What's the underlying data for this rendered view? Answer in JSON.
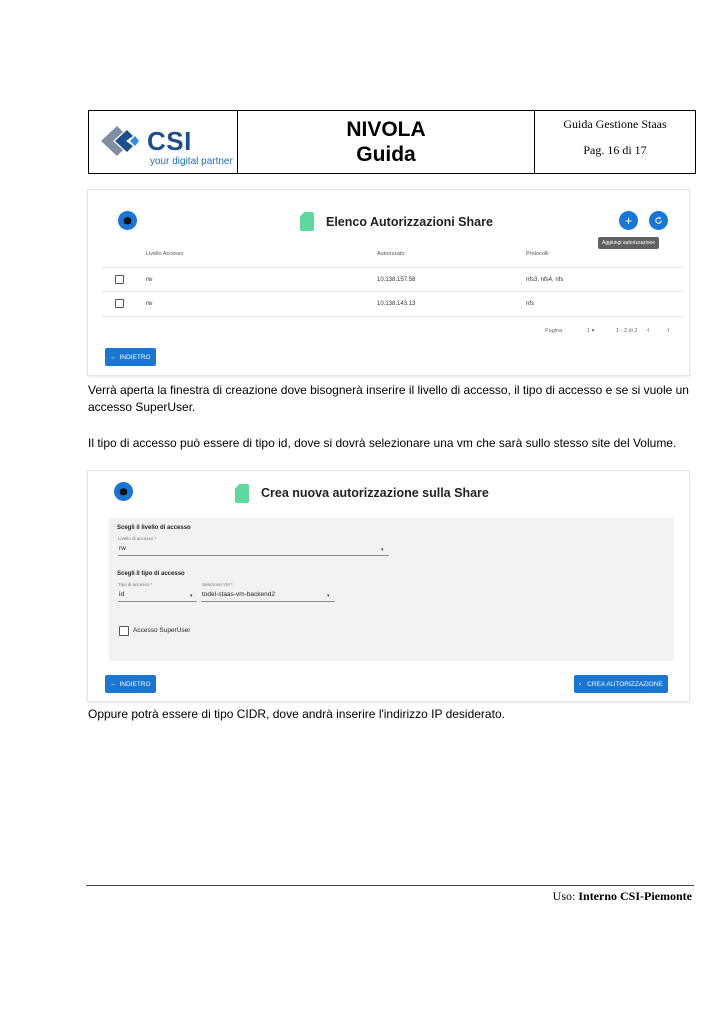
{
  "header": {
    "logo_text": "CSI",
    "logo_tagline": "your digital partner",
    "title": "NIVOLA",
    "subtitle": "Guida",
    "guide_name": "Guida Gestione Staas",
    "page": "Pag. 16 di 17"
  },
  "screenshot1": {
    "title": "Elenco Autorizzazioni Share",
    "add_icon": "plus-icon",
    "refresh_icon": "refresh-icon",
    "tooltip": "Aggiungi autorizzazione",
    "columns": [
      "Livello Accesso",
      "Autorizzato",
      "Protocolli"
    ],
    "rows": [
      {
        "livello": "rw",
        "autorizzato": "10.138.157.58",
        "protocolli": "nfs3, nfs4, nfs"
      },
      {
        "livello": "rw",
        "autorizzato": "10.138.143.13",
        "protocolli": "nfs"
      }
    ],
    "pagination": {
      "label": "Pagina",
      "page": "1",
      "range": "1 - 2 di 2"
    },
    "back_button": "INDIETRO"
  },
  "paragraphs": {
    "p1": "Verrà aperta la finestra di creazione dove bisognerà inserire il livello di accesso, il tipo di accesso e se si vuole un accesso SuperUser.",
    "p2": "Il tipo di accesso può essere di tipo id, dove si dovrà selezionare una vm che sarà sullo stesso site del Volume.",
    "p3": "Oppure potrà essere di tipo CIDR, dove andrà inserire l'indirizzo IP desiderato."
  },
  "screenshot2": {
    "title": "Crea nuova autorizzazione sulla Share",
    "section1_title": "Scegli il livello di accesso",
    "livello_label": "Livello di accesso *",
    "livello_value": "rw",
    "section2_title": "Scegli il tipo di accesso",
    "tipo_label": "Tipo di accesso *",
    "tipo_value": "id",
    "vm_label": "Seleziona VM *",
    "vm_value": "todel-staas-vm-backend2",
    "superuser_label": "Accesso SuperUser",
    "back_button": "INDIETRO",
    "create_button": "CREA AUTORIZZAZIONE"
  },
  "footer": {
    "prefix": "Uso: ",
    "value": "Interno CSI-Piemonte"
  },
  "colors": {
    "primary": "#1976d2",
    "sd_card": "#5fd8a0",
    "csi_blue": "#1c4f8b"
  }
}
